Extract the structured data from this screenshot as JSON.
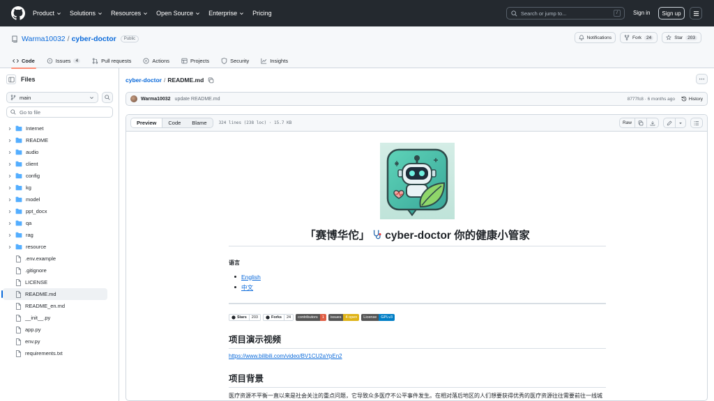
{
  "nav": {
    "items": [
      "Product",
      "Solutions",
      "Resources",
      "Open Source",
      "Enterprise",
      "Pricing"
    ],
    "search_placeholder": "Search or jump to...",
    "search_key": "/",
    "sign_in": "Sign in",
    "sign_up": "Sign up"
  },
  "repo": {
    "owner": "Warma10032",
    "separator": "/",
    "name": "cyber-doctor",
    "visibility": "Public",
    "notifications_label": "Notifications",
    "fork_label": "Fork",
    "fork_count": "24",
    "star_label": "Star",
    "star_count": "203"
  },
  "tabs": [
    {
      "label": "Code",
      "icon": "code-icon",
      "active": true
    },
    {
      "label": "Issues",
      "icon": "issue-icon",
      "count": "4"
    },
    {
      "label": "Pull requests",
      "icon": "pull-request-icon"
    },
    {
      "label": "Actions",
      "icon": "play-icon"
    },
    {
      "label": "Projects",
      "icon": "table-icon"
    },
    {
      "label": "Security",
      "icon": "shield-icon"
    },
    {
      "label": "Insights",
      "icon": "graph-icon"
    }
  ],
  "sidebar": {
    "title": "Files",
    "branch": "main",
    "goto_placeholder": "Go to file",
    "tree": [
      {
        "name": "Internet",
        "type": "folder"
      },
      {
        "name": "README",
        "type": "folder"
      },
      {
        "name": "audio",
        "type": "folder"
      },
      {
        "name": "client",
        "type": "folder"
      },
      {
        "name": "config",
        "type": "folder"
      },
      {
        "name": "kg",
        "type": "folder"
      },
      {
        "name": "model",
        "type": "folder"
      },
      {
        "name": "ppt_docx",
        "type": "folder"
      },
      {
        "name": "qa",
        "type": "folder"
      },
      {
        "name": "rag",
        "type": "folder"
      },
      {
        "name": "resource",
        "type": "folder"
      },
      {
        "name": ".env.example",
        "type": "file"
      },
      {
        "name": ".gitignore",
        "type": "file"
      },
      {
        "name": "LICENSE",
        "type": "file"
      },
      {
        "name": "README.md",
        "type": "file",
        "selected": true
      },
      {
        "name": "README_en.md",
        "type": "file"
      },
      {
        "name": "__init__.py",
        "type": "file"
      },
      {
        "name": "app.py",
        "type": "file"
      },
      {
        "name": "env.py",
        "type": "file"
      },
      {
        "name": "requirements.txt",
        "type": "file"
      }
    ]
  },
  "breadcrumb": {
    "repo": "cyber-doctor",
    "sep": "/",
    "file": "README.md"
  },
  "commit": {
    "author": "Warma10032",
    "message": "update README.md",
    "meta": "8777fc8 · 6 months ago",
    "history": "History"
  },
  "viewer": {
    "modes": [
      "Preview",
      "Code",
      "Blame"
    ],
    "info": "324 lines (238 loc) · 15.7 KB",
    "raw": "Raw"
  },
  "readme": {
    "title_left": "「赛博华佗」",
    "title_right": "cyber-doctor 你的健康小管家",
    "lang_heading": "语言",
    "lang_links": [
      "English",
      "中文"
    ],
    "badges": [
      {
        "label": "Stars",
        "value": "203",
        "style": "gh"
      },
      {
        "label": "Forks",
        "value": "24",
        "style": "gh"
      },
      {
        "label": "contributors",
        "value": "1",
        "color": "#e05d44"
      },
      {
        "label": "issues",
        "value": "4 open",
        "color": "#dfb317"
      },
      {
        "label": "License",
        "value": "GPLv3",
        "color": "#007ec6"
      }
    ],
    "h_demo": "项目演示视频",
    "demo_url": "https://www.bilibili.com/video/BV1CU2aYpEn2",
    "h_background": "项目背景",
    "background_text": "医疗资源不平衡一直以来是社会关注的重点问题，它导致众多医疗不公平事件发生。在相对落后地区的人们想要获得优秀的医疗资源往往需要前往一线城市，这不仅费时费力费钱，而且极大的影响了他们的接受医疗救助的基本权利。当前多模态大语言模型不断发展，在许多领域都有了不"
  }
}
